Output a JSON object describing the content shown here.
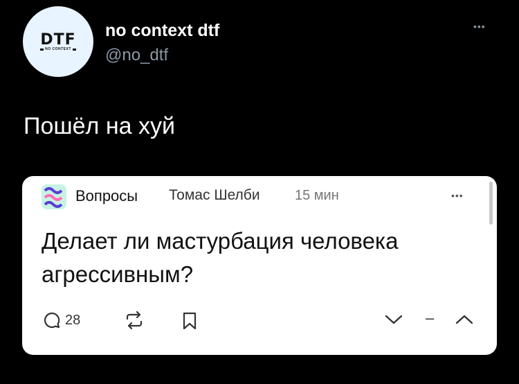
{
  "profile": {
    "logo_main": "DTF",
    "logo_sub": "NO CONTEXT",
    "name": "no context dtf",
    "handle": "@no_dtf",
    "more": "•••"
  },
  "tweet": {
    "text": "Пошёл на хуй"
  },
  "card": {
    "category": "Вопросы",
    "author": "Томас Шелби",
    "time": "15 мин",
    "more": "•••",
    "title": "Делает ли мастурбация человека агрессивным?",
    "comments_count": "28",
    "vote_separator": "–"
  },
  "colors": {
    "background": "#000000",
    "card": "#ffffff",
    "muted": "#8b98a5"
  },
  "icons": [
    "comment-icon",
    "repost-icon",
    "bookmark-icon",
    "downvote-icon",
    "upvote-icon"
  ]
}
